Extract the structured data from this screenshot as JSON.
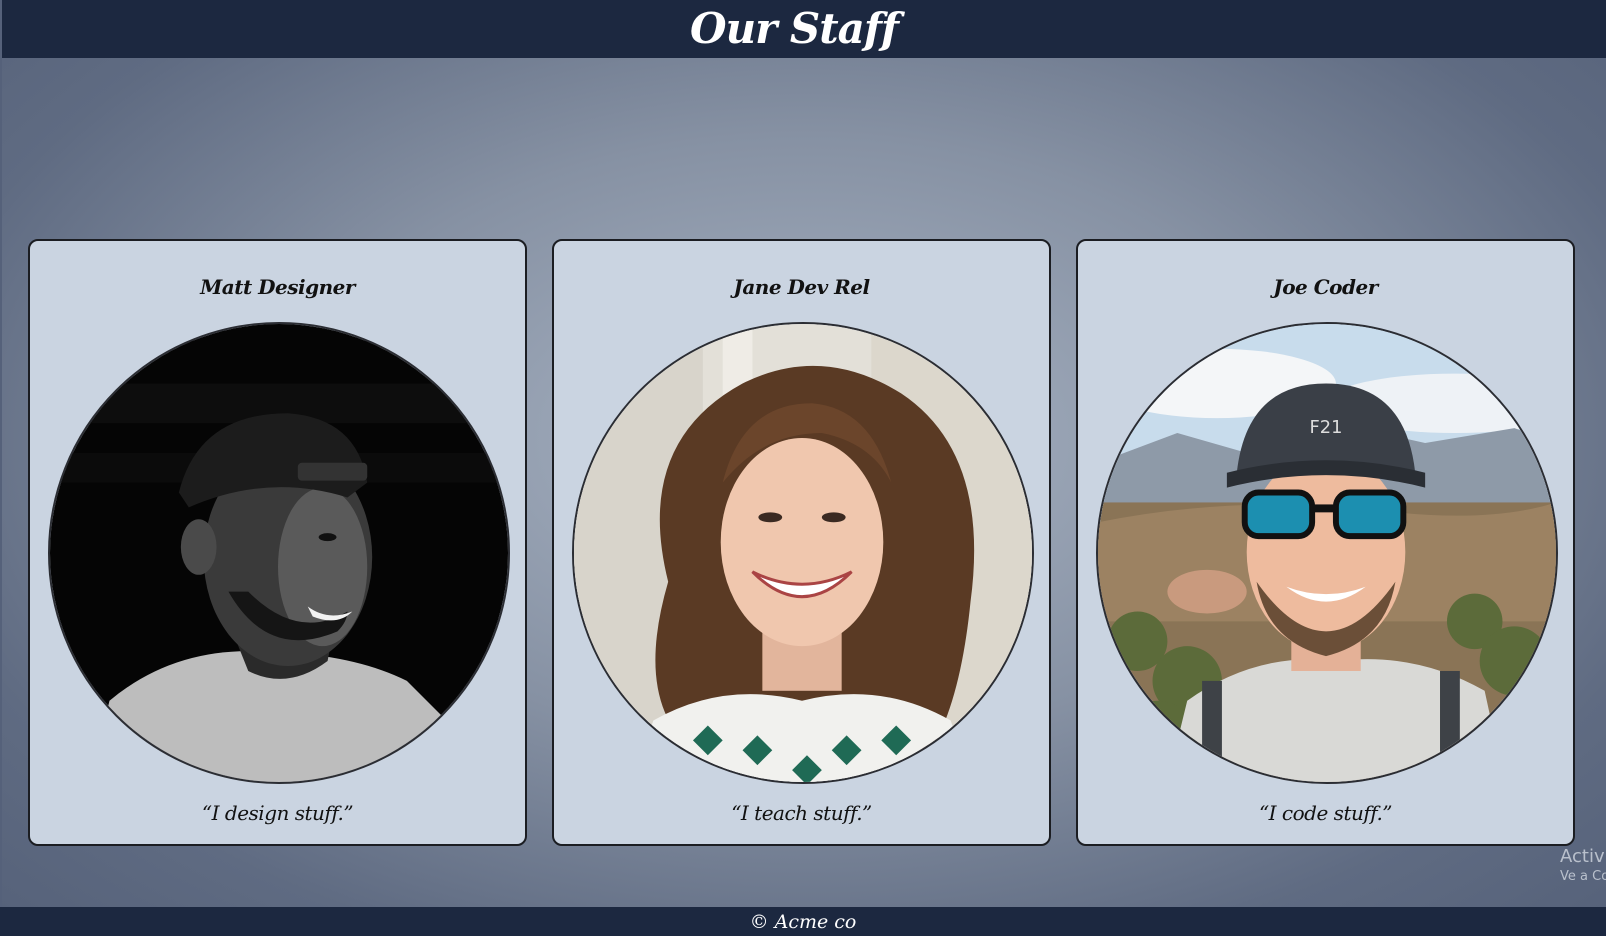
{
  "header": {
    "title": "Our Staff"
  },
  "staff": [
    {
      "name": "Matt Designer",
      "quote": "“I design stuff.”",
      "photo_icon": "portrait-bw-man-cap"
    },
    {
      "name": "Jane Dev Rel",
      "quote": "“I teach stuff.”",
      "photo_icon": "portrait-woman-curly-hair"
    },
    {
      "name": "Joe Coder",
      "quote": "“I code stuff.”",
      "photo_icon": "portrait-man-sunglasses-mountains"
    }
  ],
  "footer": {
    "text": "© Acme co"
  },
  "watermark": {
    "line1": "Activ",
    "line2": "Ve a Co"
  },
  "colors": {
    "header_bg": "#1c2840",
    "card_bg": "#cad4e1",
    "card_border": "#1b1d22",
    "page_bg_center": "#a9b4c4",
    "page_bg_edge": "#56627a"
  }
}
